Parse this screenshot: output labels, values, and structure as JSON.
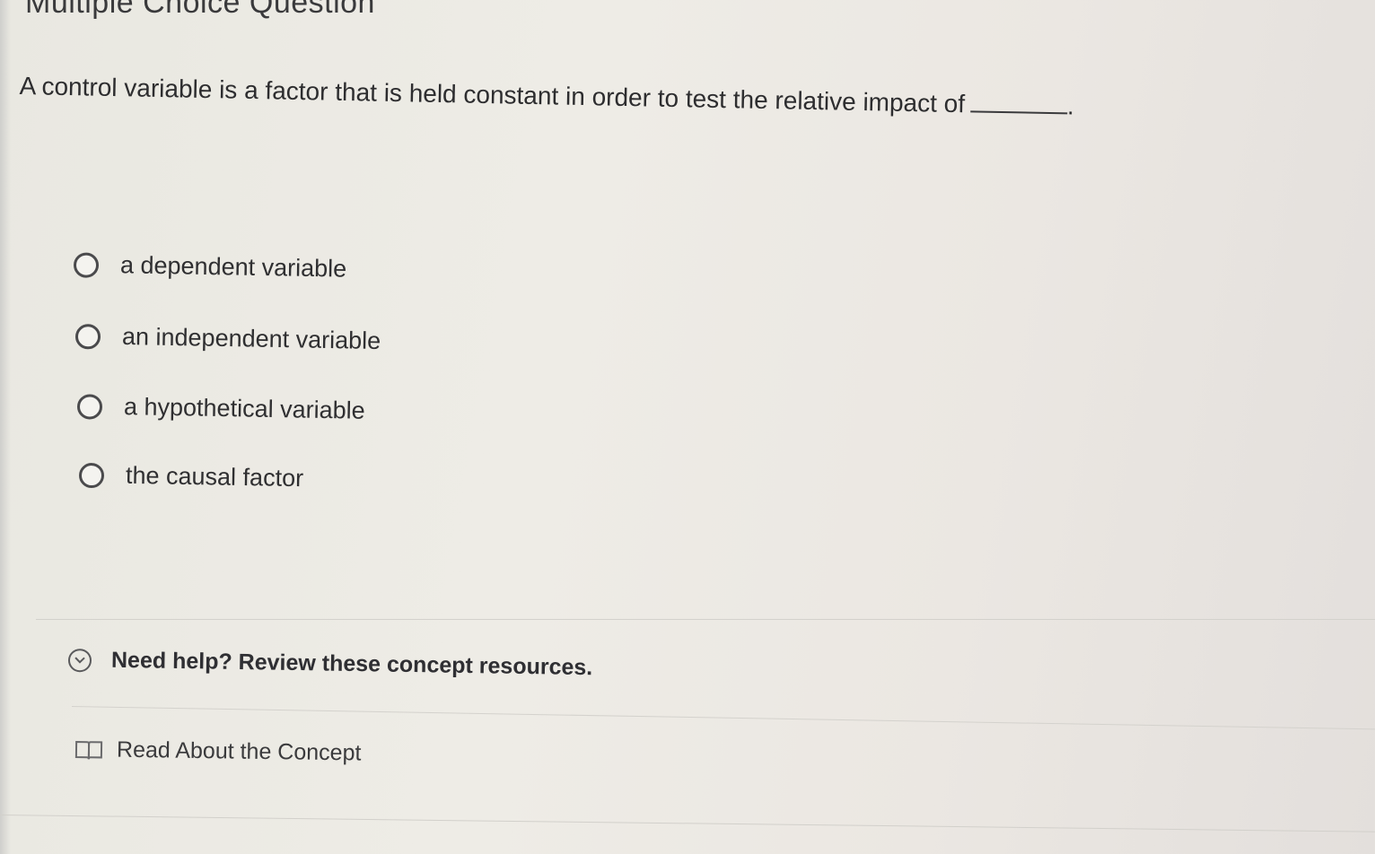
{
  "header": {
    "title": "Multiple Choice Question"
  },
  "question": {
    "text": "A control variable is a factor that is held constant in order to test the relative impact of",
    "end": "."
  },
  "options": [
    {
      "label": "a dependent variable"
    },
    {
      "label": "an independent variable"
    },
    {
      "label": "a hypothetical variable"
    },
    {
      "label": "the causal factor"
    }
  ],
  "help": {
    "toggle_label": "Need help? Review these concept resources.",
    "resources": [
      {
        "label": "Read About the Concept",
        "icon": "book-icon"
      }
    ]
  },
  "colors": {
    "text": "#2f2f31",
    "background": "#eeece6",
    "divider": "#d4d2cd"
  }
}
